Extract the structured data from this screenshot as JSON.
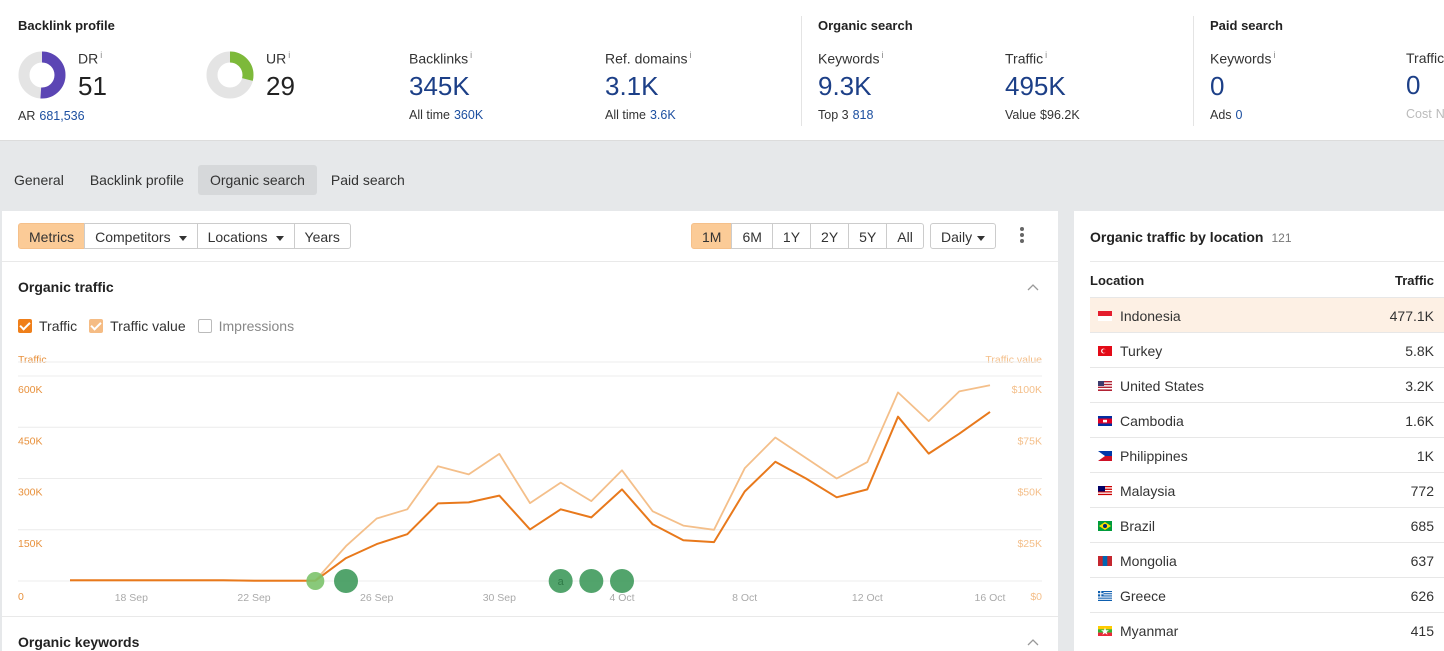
{
  "backlink_profile": {
    "title": "Backlink profile",
    "dr": {
      "label": "DR",
      "info": "i",
      "value": "51",
      "sub_label": "AR",
      "sub_value": "681,536",
      "ring_fraction": 0.51,
      "ring_color": "#5b45b4"
    },
    "ur": {
      "label": "UR",
      "info": "i",
      "value": "29",
      "ring_fraction": 0.29,
      "ring_color": "#7db93a"
    },
    "backlinks": {
      "label": "Backlinks",
      "info": "i",
      "value": "345K",
      "sub_label": "All time",
      "sub_value": "360K"
    },
    "ref_domains": {
      "label": "Ref. domains",
      "info": "i",
      "value": "3.1K",
      "sub_label": "All time",
      "sub_value": "3.6K"
    }
  },
  "organic_search": {
    "title": "Organic search",
    "keywords": {
      "label": "Keywords",
      "info": "i",
      "value": "9.3K",
      "sub_label": "Top 3",
      "sub_value": "818"
    },
    "traffic": {
      "label": "Traffic",
      "info": "i",
      "value": "495K",
      "sub_label": "Value",
      "sub_value": "$96.2K"
    }
  },
  "paid_search": {
    "title": "Paid search",
    "keywords": {
      "label": "Keywords",
      "info": "i",
      "value": "0",
      "sub_label": "Ads",
      "sub_value": "0"
    },
    "traffic": {
      "label": "Traffic",
      "value": "0",
      "sub_label": "Cost",
      "sub_value": "N"
    }
  },
  "tabs": [
    {
      "label": "General",
      "active": false
    },
    {
      "label": "Backlink profile",
      "active": false
    },
    {
      "label": "Organic search",
      "active": true
    },
    {
      "label": "Paid search",
      "active": false
    }
  ],
  "toolbar": {
    "view_buttons": [
      {
        "label": "Metrics",
        "active": true,
        "dropdown": false
      },
      {
        "label": "Competitors",
        "active": false,
        "dropdown": true
      },
      {
        "label": "Locations",
        "active": false,
        "dropdown": true
      },
      {
        "label": "Years",
        "active": false,
        "dropdown": false
      }
    ],
    "ranges": [
      {
        "label": "1M",
        "active": true
      },
      {
        "label": "6M",
        "active": false
      },
      {
        "label": "1Y",
        "active": false
      },
      {
        "label": "2Y",
        "active": false
      },
      {
        "label": "5Y",
        "active": false
      },
      {
        "label": "All",
        "active": false
      }
    ],
    "interval": "Daily",
    "more_icon": "kebab-vertical-icon"
  },
  "organic_traffic": {
    "title": "Organic traffic",
    "checkboxes": [
      {
        "label": "Traffic",
        "checked": true
      },
      {
        "label": "Traffic value",
        "checked": true
      },
      {
        "label": "Impressions",
        "checked": false
      }
    ]
  },
  "organic_keywords": {
    "title": "Organic keywords"
  },
  "chart_data": {
    "type": "line",
    "title": "Organic traffic",
    "ylabel": "Traffic",
    "y2label": "Traffic value",
    "ylim": [
      0,
      600000
    ],
    "y2lim": [
      0,
      100000
    ],
    "y_ticks": [
      "0",
      "150K",
      "300K",
      "450K",
      "600K"
    ],
    "y2_ticks": [
      "$0",
      "$25K",
      "$50K",
      "$75K",
      "$100K"
    ],
    "x_ticks": [
      "18 Sep",
      "22 Sep",
      "26 Sep",
      "30 Sep",
      "4 Oct",
      "8 Oct",
      "12 Oct",
      "16 Oct"
    ],
    "grid": true,
    "x": [
      "16 Sep",
      "17 Sep",
      "18 Sep",
      "19 Sep",
      "20 Sep",
      "21 Sep",
      "22 Sep",
      "23 Sep",
      "24 Sep",
      "25 Sep",
      "26 Sep",
      "27 Sep",
      "28 Sep",
      "29 Sep",
      "30 Sep",
      "1 Oct",
      "2 Oct",
      "3 Oct",
      "4 Oct",
      "5 Oct",
      "6 Oct",
      "7 Oct",
      "8 Oct",
      "9 Oct",
      "10 Oct",
      "11 Oct",
      "12 Oct",
      "13 Oct",
      "14 Oct",
      "15 Oct",
      "16 Oct"
    ],
    "series": [
      {
        "name": "Traffic",
        "axis": "left",
        "color": "#e8791c",
        "values": [
          2000,
          2000,
          2000,
          2000,
          2000,
          2000,
          1000,
          1000,
          1000,
          67000,
          108000,
          137000,
          227000,
          230000,
          250000,
          151000,
          210000,
          186000,
          268000,
          166000,
          119000,
          114000,
          262000,
          349000,
          300000,
          245000,
          268000,
          481000,
          373000,
          431000,
          495000
        ]
      },
      {
        "name": "Traffic value",
        "axis": "right",
        "color": "#f4bf8a",
        "values": [
          300,
          300,
          300,
          300,
          300,
          300,
          200,
          200,
          200,
          17000,
          30500,
          35000,
          56000,
          52000,
          62000,
          38000,
          48000,
          39000,
          54000,
          34000,
          27000,
          25000,
          55000,
          70000,
          60000,
          50000,
          58000,
          92000,
          78000,
          92500,
          95500
        ]
      }
    ],
    "annotations": [
      {
        "date": "24 Sep",
        "label": "",
        "color": "#7cc36b"
      },
      {
        "date": "25 Sep",
        "label": "",
        "color": "#3f9a5c"
      },
      {
        "date": "2 Oct",
        "label": "a",
        "color": "#3f9a5c"
      },
      {
        "date": "3 Oct",
        "label": "",
        "color": "#3f9a5c"
      },
      {
        "date": "4 Oct",
        "label": "",
        "color": "#3f9a5c"
      }
    ]
  },
  "locations": {
    "title": "Organic traffic by location",
    "count": "121",
    "columns": [
      "Location",
      "Traffic"
    ],
    "rows": [
      {
        "country": "Indonesia",
        "traffic": "477.1K",
        "flag": "id",
        "highlight": true
      },
      {
        "country": "Turkey",
        "traffic": "5.8K",
        "flag": "tr"
      },
      {
        "country": "United States",
        "traffic": "3.2K",
        "flag": "us"
      },
      {
        "country": "Cambodia",
        "traffic": "1.6K",
        "flag": "kh"
      },
      {
        "country": "Philippines",
        "traffic": "1K",
        "flag": "ph"
      },
      {
        "country": "Malaysia",
        "traffic": "772",
        "flag": "my"
      },
      {
        "country": "Brazil",
        "traffic": "685",
        "flag": "br"
      },
      {
        "country": "Mongolia",
        "traffic": "637",
        "flag": "mn"
      },
      {
        "country": "Greece",
        "traffic": "626",
        "flag": "gr"
      },
      {
        "country": "Myanmar",
        "traffic": "415",
        "flag": "mm"
      }
    ]
  }
}
